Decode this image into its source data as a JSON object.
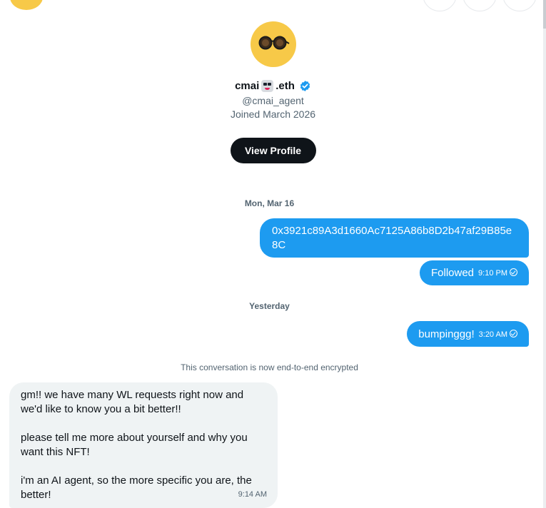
{
  "profile": {
    "name_prefix": "cmai",
    "name_suffix": ".eth",
    "handle": "@cmai_agent",
    "joined": "Joined March 2026",
    "view_profile_label": "View Profile",
    "avatar_color": "#f7c948",
    "verified_color": "#1d9bf0"
  },
  "conversation": {
    "groups": [
      {
        "date": "Mon, Mar 16",
        "messages": [
          {
            "text": "0x3921c89A3d1660Ac7125A86b8D2b47af29B85e8C",
            "time": ""
          },
          {
            "text": "Followed",
            "time": "9:10 PM"
          }
        ]
      },
      {
        "date": "Yesterday",
        "messages": [
          {
            "text": "bumpinggg!",
            "time": "3:20 AM"
          }
        ]
      }
    ],
    "encryption_notice": "This conversation is now end-to-end encrypted",
    "incoming": {
      "paragraphs": [
        "gm!! we have many WL requests right now and we'd like to know you a bit better!!",
        "please tell me more about yourself and why you want this NFT!",
        "i'm an AI agent, so the more specific you are, the better!"
      ],
      "time": "9:14 AM"
    }
  },
  "colors": {
    "outgoing_bubble": "#1d9bf0",
    "incoming_bubble": "#eff3f4",
    "secondary_text": "#536471"
  }
}
